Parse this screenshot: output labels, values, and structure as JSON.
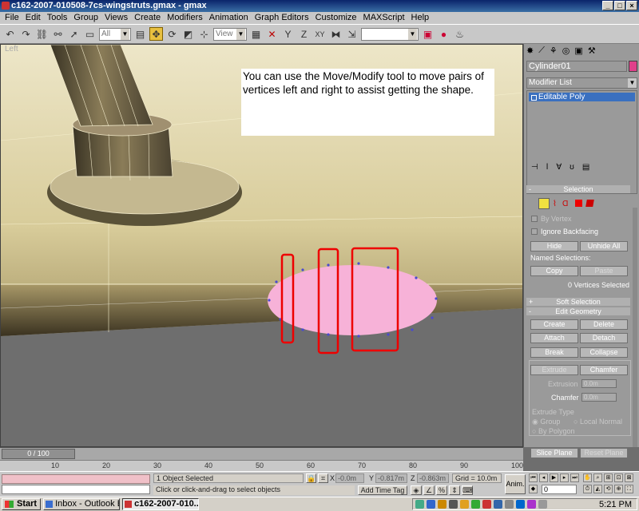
{
  "window": {
    "title": "c162-2007-010508-7cs-wingstruts.gmax - gmax",
    "btn_min": "_",
    "btn_max": "□",
    "btn_close": "×"
  },
  "menu": [
    "File",
    "Edit",
    "Tools",
    "Group",
    "Views",
    "Create",
    "Modifiers",
    "Animation",
    "Graph Editors",
    "Customize",
    "MAXScript",
    "Help"
  ],
  "toolbar": {
    "filter_value": "All",
    "refcoord_value": "View",
    "named_sel_value": ""
  },
  "viewport": {
    "label": "Left",
    "annotation": "You can use the Move/Modify tool to move pairs of vertices left and right to assist getting the shape."
  },
  "panel": {
    "object_name": "Cylinder01",
    "object_color": "#e0408a",
    "modifier_list": "Modifier List",
    "stack_item": "Editable Poly",
    "selection_title": "Selection",
    "by_vertex": "By Vertex",
    "ignore_backfacing": "Ignore Backfacing",
    "hide": "Hide",
    "unhide_all": "Unhide All",
    "named_selections": "Named Selections:",
    "copy": "Copy",
    "paste": "Paste",
    "vertices_selected": "0 Vertices Selected",
    "soft_selection": "Soft Selection",
    "edit_geometry": "Edit Geometry",
    "create": "Create",
    "delete": "Delete",
    "attach": "Attach",
    "detach": "Detach",
    "break": "Break",
    "collapse": "Collapse",
    "extrude": "Extrude",
    "chamfer": "Chamfer",
    "extrusion_label": "Extrusion",
    "extrusion_value": "0.0m",
    "chamfer_label": "Chamfer",
    "chamfer_value": "0.0m",
    "extrude_type": "Extrude Type",
    "group": "Group",
    "local_normal": "Local Normal",
    "by_polygon": "By Polygon",
    "slice_plane": "Slice Plane",
    "reset_plane": "Reset Plane",
    "plus": "+",
    "minus": "-"
  },
  "timeline": {
    "frame": "0 / 100",
    "ticks": [
      "10",
      "20",
      "30",
      "40",
      "50",
      "60",
      "70",
      "80",
      "90",
      "100"
    ]
  },
  "status": {
    "objects_selected": "1 Object Selected",
    "prompt": "Click or click-and-drag to select objects",
    "x_label": "X",
    "x_value": "-0.0m",
    "y_label": "Y",
    "y_value": "-0.817m",
    "z_label": "Z",
    "z_value": "-0.863m",
    "grid": "Grid = 10.0m",
    "add_time_tag": "Add Time Tag",
    "anim": "Anim.",
    "frame_value": "0"
  },
  "taskbar": {
    "start": "Start",
    "tasks": [
      "Inbox - Outlook E...",
      "c162-2007-010..."
    ],
    "clock": "5:21 PM"
  }
}
